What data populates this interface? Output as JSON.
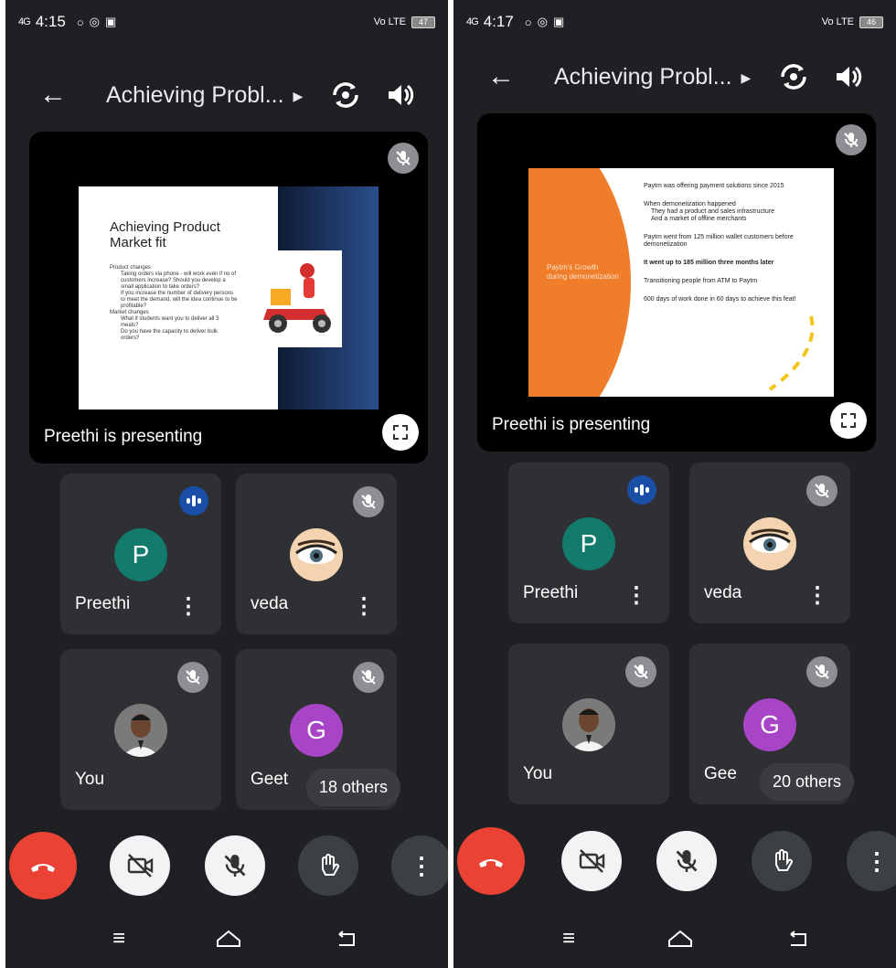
{
  "screens": [
    {
      "status": {
        "signal": "4G",
        "time": "4:15",
        "icons": [
          "circle-icon",
          "whatsapp-icon",
          "briefcase-icon"
        ],
        "network": "Vo LTE",
        "battery": "47"
      },
      "topbar": {
        "title": "Achieving Probl..."
      },
      "presentation": {
        "label": "Preethi is presenting",
        "slide": {
          "heading": "Achieving Product Market fit",
          "bullets": [
            "Product changes",
            "Taking orders via phone - will work even if no of customers increase? Should you develop a small application to take orders?",
            "If you increase the number of delivery persons to meet the demand, will the idea continue to be profitable?",
            "Market changes",
            "What if students want you to deliver all 3 meals?",
            "Do you have the capacity to deliver bulk orders?"
          ]
        }
      },
      "participants": [
        {
          "name": "Preethi",
          "initial": "P",
          "color": "#137a6e",
          "state": "speaking"
        },
        {
          "name": "veda",
          "initial": "",
          "color": "#f3d3b0",
          "state": "muted"
        },
        {
          "name": "You",
          "initial": "",
          "color": "#6b6b6b",
          "state": "muted"
        },
        {
          "name": "Geet",
          "initial": "G",
          "color": "#a845c6",
          "state": "muted",
          "others": "18 others"
        }
      ]
    },
    {
      "status": {
        "signal": "4G",
        "time": "4:17",
        "icons": [
          "circle-icon",
          "whatsapp-icon",
          "briefcase-icon"
        ],
        "network": "Vo LTE",
        "battery": "46"
      },
      "topbar": {
        "title": "Achieving Probl..."
      },
      "presentation": {
        "label": "Preethi is presenting",
        "slide": {
          "left": "Paytm's Growth during demonetization",
          "bullets": [
            "Paytm was offering payment solutions since 2015",
            "When demonetization happened",
            "They had a product and sales infrastructure",
            "And a market of offline merchants",
            "Paytm went from 125 million wallet customers before demonetization",
            "It went up to 185 million three months later",
            "Transitioning people from ATM to Paytm",
            "600 days of work done in 60 days to achieve this feat!"
          ]
        }
      },
      "participants": [
        {
          "name": "Preethi",
          "initial": "P",
          "color": "#137a6e",
          "state": "speaking"
        },
        {
          "name": "veda",
          "initial": "",
          "color": "#f3d3b0",
          "state": "muted"
        },
        {
          "name": "You",
          "initial": "",
          "color": "#6b6b6b",
          "state": "muted"
        },
        {
          "name": "Gee",
          "initial": "G",
          "color": "#a845c6",
          "state": "muted",
          "others": "20 others"
        }
      ]
    }
  ],
  "colors": {
    "background": "#1f2023",
    "tile": "#2f3033",
    "end_call": "#ea4335",
    "speaking": "#1a4fa8",
    "orange": "#ef7d2a"
  }
}
